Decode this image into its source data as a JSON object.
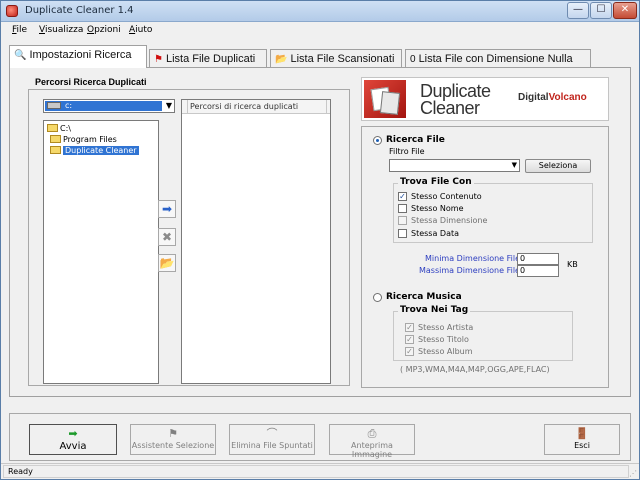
{
  "window": {
    "title": "Duplicate Cleaner 1.4",
    "controls": {
      "minimize": "—",
      "maximize": "☐",
      "close": "✕"
    }
  },
  "menu": [
    {
      "accel": "F",
      "rest": "ile"
    },
    {
      "accel": "V",
      "rest": "isualizza"
    },
    {
      "accel": "O",
      "rest": "pzioni"
    },
    {
      "accel": "A",
      "rest": "iuto"
    }
  ],
  "tabs": [
    {
      "icon": "magnifier-icon",
      "glyph": "🔍",
      "label": "Impostazioni Ricerca",
      "active": true
    },
    {
      "icon": "red-flag-icon",
      "glyph": "⚑",
      "label": "Lista File Duplicati",
      "active": false
    },
    {
      "icon": "folder-icon",
      "glyph": "📂",
      "label": "Lista File Scansionati",
      "active": false
    },
    {
      "icon": "zero-icon",
      "glyph": "0",
      "label": "Lista File con Dimensione Nulla",
      "active": false
    }
  ],
  "search_paths": {
    "group_title": "Percorsi Ricerca Duplicati",
    "drive": "c:",
    "tree": [
      "C:\\",
      "Program Files",
      "Duplicate Cleaner"
    ],
    "list_header": "Percorsi di ricerca duplicati",
    "buttons": {
      "add": "➡",
      "remove": "✖",
      "browse": "📂"
    }
  },
  "logo": {
    "line1": "Duplicate",
    "line2": "Cleaner",
    "brand_a": "Digital",
    "brand_b": "Volcano"
  },
  "file_search": {
    "radio_label": "Ricerca File",
    "filter_label": "Filtro File",
    "filter_value": "",
    "select_button": "Seleziona",
    "find_title": "Trova File Con",
    "options": [
      {
        "label": "Stesso Contenuto",
        "checked": true,
        "enabled": true
      },
      {
        "label": "Stesso Nome",
        "checked": false,
        "enabled": true
      },
      {
        "label": "Stessa Dimensione",
        "checked": false,
        "enabled": false
      },
      {
        "label": "Stessa Data",
        "checked": false,
        "enabled": true
      }
    ],
    "min_size_label": "Minima Dimensione File",
    "min_size_value": "0",
    "max_size_label": "Massima Dimensione File",
    "max_size_value": "0",
    "unit": "KB"
  },
  "music_search": {
    "radio_label": "Ricerca Musica",
    "tags_title": "Trova Nei Tag",
    "options": [
      {
        "label": "Stesso Artista",
        "checked": true
      },
      {
        "label": "Stesso Titolo",
        "checked": true
      },
      {
        "label": "Stesso Album",
        "checked": true
      }
    ],
    "formats": "( MP3,WMA,M4A,M4P,OGG,APE,FLAC)"
  },
  "toolbar": {
    "start": {
      "label": "Avvia",
      "icon": "green-arrow-icon",
      "glyph": "➡"
    },
    "wizard": {
      "label": "Assistente Selezione",
      "icon": "wand-icon",
      "glyph": "⚑"
    },
    "delete": {
      "label": "Elimina File Spuntati",
      "icon": "delete-icon",
      "glyph": "⌒"
    },
    "preview": {
      "label": "Anteprima Immagine",
      "icon": "preview-icon",
      "glyph": "⎙"
    },
    "exit": {
      "label": "Esci",
      "icon": "exit-door-icon",
      "glyph": "🚪"
    }
  },
  "status": {
    "text": "Ready"
  }
}
